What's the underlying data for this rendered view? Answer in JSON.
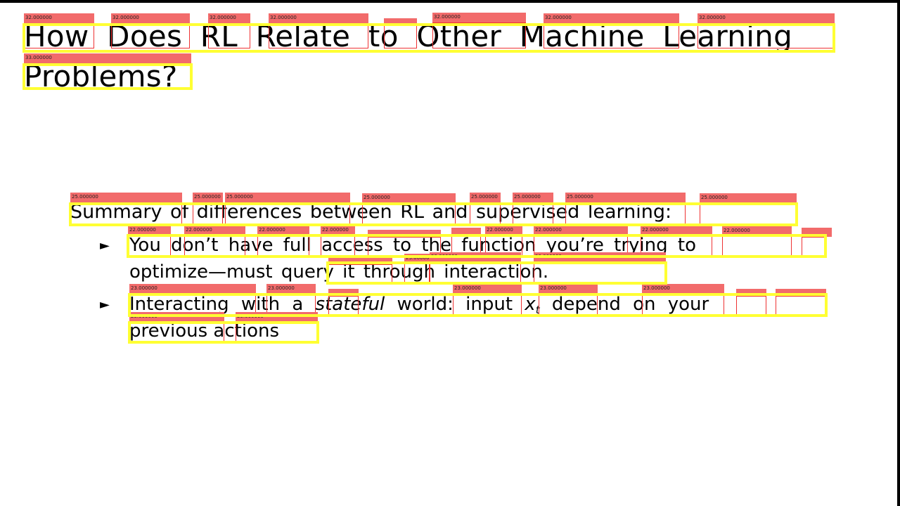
{
  "slide": {
    "title": {
      "line1": "How Does RL Relate to Other Machine Learning",
      "line2": "Problems?"
    },
    "summary": "Summary of differences between RL and supervised learning:",
    "bullets": [
      {
        "marker": "►",
        "line1": "You don’t have full access to the function you’re trying to",
        "line2": "optimize—must query it through interaction."
      },
      {
        "marker": "►",
        "line1_a": "Interacting with a",
        "line1_italic": "stateful",
        "line1_b": "world: input",
        "line1_var": "x",
        "line1_sub": "t",
        "line1_c": "depend on your",
        "line2": "previous actions"
      }
    ]
  },
  "annotations": {
    "title_size": "32.000000",
    "title_size_alt": "33.000000",
    "summary_size": "25.000000",
    "bullet1_size": "22.000000",
    "bullet_size": "23.000000",
    "bullet2_size": "25.000000",
    "word_box_color": "#ee3333",
    "word_label_color": "#f26b6b",
    "line_box_color": "#ffff33"
  }
}
